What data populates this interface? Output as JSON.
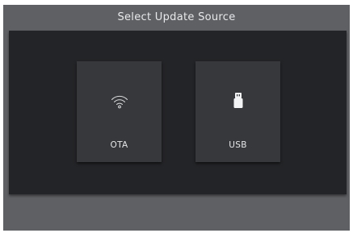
{
  "screen": {
    "title": "Select Update Source"
  },
  "sources": [
    {
      "label": "OTA",
      "icon": "wifi-icon"
    },
    {
      "label": "USB",
      "icon": "usb-drive-icon"
    }
  ],
  "colors": {
    "screen_bg": "#5e6064",
    "panel_bg": "#232427",
    "tile_bg": "#36383b",
    "text": "#e6e7e8"
  }
}
